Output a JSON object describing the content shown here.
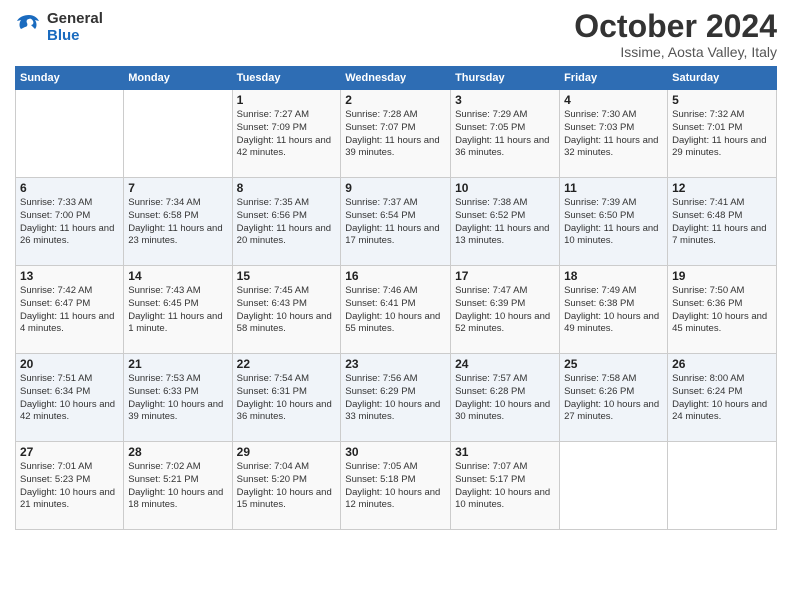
{
  "logo": {
    "line1": "General",
    "line2": "Blue"
  },
  "header": {
    "title": "October 2024",
    "location": "Issime, Aosta Valley, Italy"
  },
  "weekdays": [
    "Sunday",
    "Monday",
    "Tuesday",
    "Wednesday",
    "Thursday",
    "Friday",
    "Saturday"
  ],
  "weeks": [
    [
      {
        "day": "",
        "info": ""
      },
      {
        "day": "",
        "info": ""
      },
      {
        "day": "1",
        "info": "Sunrise: 7:27 AM\nSunset: 7:09 PM\nDaylight: 11 hours\nand 42 minutes."
      },
      {
        "day": "2",
        "info": "Sunrise: 7:28 AM\nSunset: 7:07 PM\nDaylight: 11 hours\nand 39 minutes."
      },
      {
        "day": "3",
        "info": "Sunrise: 7:29 AM\nSunset: 7:05 PM\nDaylight: 11 hours\nand 36 minutes."
      },
      {
        "day": "4",
        "info": "Sunrise: 7:30 AM\nSunset: 7:03 PM\nDaylight: 11 hours\nand 32 minutes."
      },
      {
        "day": "5",
        "info": "Sunrise: 7:32 AM\nSunset: 7:01 PM\nDaylight: 11 hours\nand 29 minutes."
      }
    ],
    [
      {
        "day": "6",
        "info": "Sunrise: 7:33 AM\nSunset: 7:00 PM\nDaylight: 11 hours\nand 26 minutes."
      },
      {
        "day": "7",
        "info": "Sunrise: 7:34 AM\nSunset: 6:58 PM\nDaylight: 11 hours\nand 23 minutes."
      },
      {
        "day": "8",
        "info": "Sunrise: 7:35 AM\nSunset: 6:56 PM\nDaylight: 11 hours\nand 20 minutes."
      },
      {
        "day": "9",
        "info": "Sunrise: 7:37 AM\nSunset: 6:54 PM\nDaylight: 11 hours\nand 17 minutes."
      },
      {
        "day": "10",
        "info": "Sunrise: 7:38 AM\nSunset: 6:52 PM\nDaylight: 11 hours\nand 13 minutes."
      },
      {
        "day": "11",
        "info": "Sunrise: 7:39 AM\nSunset: 6:50 PM\nDaylight: 11 hours\nand 10 minutes."
      },
      {
        "day": "12",
        "info": "Sunrise: 7:41 AM\nSunset: 6:48 PM\nDaylight: 11 hours\nand 7 minutes."
      }
    ],
    [
      {
        "day": "13",
        "info": "Sunrise: 7:42 AM\nSunset: 6:47 PM\nDaylight: 11 hours\nand 4 minutes."
      },
      {
        "day": "14",
        "info": "Sunrise: 7:43 AM\nSunset: 6:45 PM\nDaylight: 11 hours\nand 1 minute."
      },
      {
        "day": "15",
        "info": "Sunrise: 7:45 AM\nSunset: 6:43 PM\nDaylight: 10 hours\nand 58 minutes."
      },
      {
        "day": "16",
        "info": "Sunrise: 7:46 AM\nSunset: 6:41 PM\nDaylight: 10 hours\nand 55 minutes."
      },
      {
        "day": "17",
        "info": "Sunrise: 7:47 AM\nSunset: 6:39 PM\nDaylight: 10 hours\nand 52 minutes."
      },
      {
        "day": "18",
        "info": "Sunrise: 7:49 AM\nSunset: 6:38 PM\nDaylight: 10 hours\nand 49 minutes."
      },
      {
        "day": "19",
        "info": "Sunrise: 7:50 AM\nSunset: 6:36 PM\nDaylight: 10 hours\nand 45 minutes."
      }
    ],
    [
      {
        "day": "20",
        "info": "Sunrise: 7:51 AM\nSunset: 6:34 PM\nDaylight: 10 hours\nand 42 minutes."
      },
      {
        "day": "21",
        "info": "Sunrise: 7:53 AM\nSunset: 6:33 PM\nDaylight: 10 hours\nand 39 minutes."
      },
      {
        "day": "22",
        "info": "Sunrise: 7:54 AM\nSunset: 6:31 PM\nDaylight: 10 hours\nand 36 minutes."
      },
      {
        "day": "23",
        "info": "Sunrise: 7:56 AM\nSunset: 6:29 PM\nDaylight: 10 hours\nand 33 minutes."
      },
      {
        "day": "24",
        "info": "Sunrise: 7:57 AM\nSunset: 6:28 PM\nDaylight: 10 hours\nand 30 minutes."
      },
      {
        "day": "25",
        "info": "Sunrise: 7:58 AM\nSunset: 6:26 PM\nDaylight: 10 hours\nand 27 minutes."
      },
      {
        "day": "26",
        "info": "Sunrise: 8:00 AM\nSunset: 6:24 PM\nDaylight: 10 hours\nand 24 minutes."
      }
    ],
    [
      {
        "day": "27",
        "info": "Sunrise: 7:01 AM\nSunset: 5:23 PM\nDaylight: 10 hours\nand 21 minutes."
      },
      {
        "day": "28",
        "info": "Sunrise: 7:02 AM\nSunset: 5:21 PM\nDaylight: 10 hours\nand 18 minutes."
      },
      {
        "day": "29",
        "info": "Sunrise: 7:04 AM\nSunset: 5:20 PM\nDaylight: 10 hours\nand 15 minutes."
      },
      {
        "day": "30",
        "info": "Sunrise: 7:05 AM\nSunset: 5:18 PM\nDaylight: 10 hours\nand 12 minutes."
      },
      {
        "day": "31",
        "info": "Sunrise: 7:07 AM\nSunset: 5:17 PM\nDaylight: 10 hours\nand 10 minutes."
      },
      {
        "day": "",
        "info": ""
      },
      {
        "day": "",
        "info": ""
      }
    ]
  ]
}
